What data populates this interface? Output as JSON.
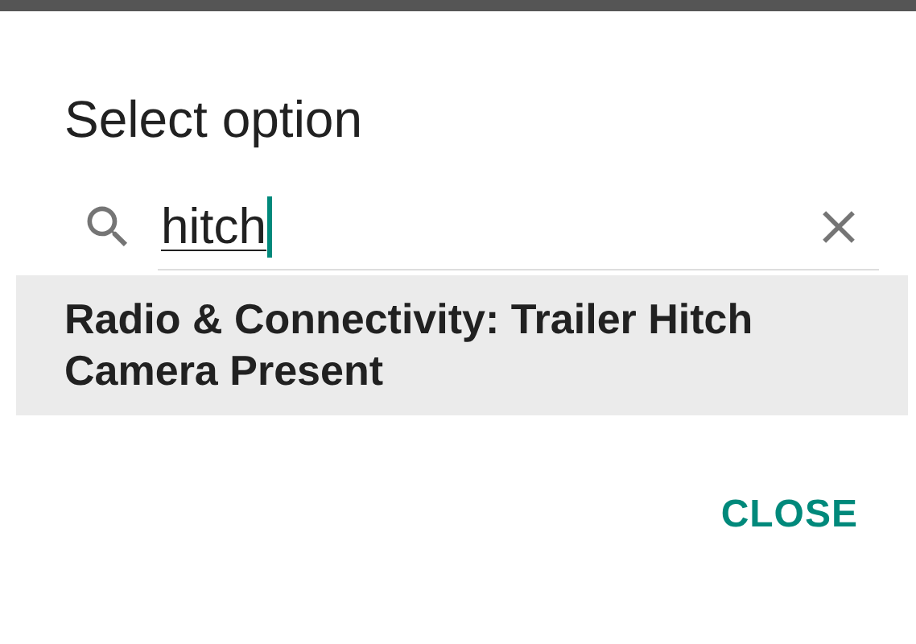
{
  "dialog": {
    "title": "Select option"
  },
  "search": {
    "value": "hitch"
  },
  "results": [
    {
      "label": "Radio & Connectivity: Trailer Hitch Camera Present",
      "selected": true
    }
  ],
  "buttons": [
    {
      "label": "CLOSE"
    }
  ]
}
